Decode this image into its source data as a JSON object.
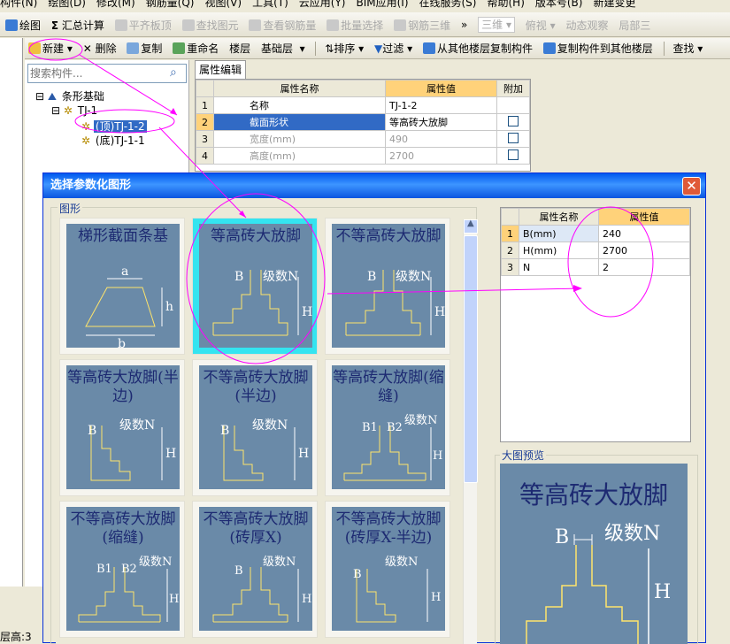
{
  "menu": [
    "构件(N)",
    "绘图(D)",
    "修改(M)",
    "钢筋量(Q)",
    "视图(V)",
    "工具(T)",
    "云应用(Y)",
    "BIM应用(I)",
    "在线服务(S)",
    "帮助(H)",
    "版本号(B)",
    "新建变更"
  ],
  "toolbar1": {
    "draw": "绘图",
    "sum": "汇总计算",
    "flat": "平齐板顶",
    "find": "查找图元",
    "view_rebar": "查看钢筋量",
    "batch": "批量选择",
    "rebar3d": "钢筋三维",
    "more": "»",
    "view_combo": "三维",
    "top_view": "俯视",
    "dynamic": "动态观察",
    "local": "局部三"
  },
  "toolbar2": {
    "new": "新建",
    "delete": "删除",
    "copy": "复制",
    "rename": "重命名",
    "floor_label": "楼层",
    "floor_value": "基础层",
    "sort": "排序",
    "filter": "过滤",
    "copy_from": "从其他楼层复制构件",
    "copy_to": "复制构件到其他楼层",
    "find": "查找"
  },
  "search": {
    "placeholder": "搜索构件..."
  },
  "tree": {
    "root": "条形基础",
    "node": "TJ-1",
    "child1": "(顶)TJ-1-2",
    "child2": "(底)TJ-1-1"
  },
  "prop_tab": "属性编辑",
  "prop_headers": {
    "name": "属性名称",
    "value": "属性值",
    "extra": "附加"
  },
  "props": [
    {
      "n": "1",
      "name": "名称",
      "value": "TJ-1-2"
    },
    {
      "n": "2",
      "name": "截面形状",
      "value": "等高砖大放脚"
    },
    {
      "n": "3",
      "name": "宽度(mm)",
      "value": "490"
    },
    {
      "n": "4",
      "name": "高度(mm)",
      "value": "2700"
    }
  ],
  "dialog": {
    "title": "选择参数化图形",
    "close": "✕",
    "group_label": "图形",
    "preview_label": "大图预览"
  },
  "tiles": [
    {
      "title": "梯形截面条基"
    },
    {
      "title": "等高砖大放脚"
    },
    {
      "title": "不等高砖大放脚"
    },
    {
      "title": "等高砖大放脚(半边)"
    },
    {
      "title": "不等高砖大放脚(半边)"
    },
    {
      "title": "等高砖大放脚(缩缝)"
    },
    {
      "title": "不等高砖大放脚(缩缝)"
    },
    {
      "title": "不等高砖大放脚(砖厚X)"
    },
    {
      "title": "不等高砖大放脚(砖厚X-半边)"
    }
  ],
  "tile_labels": {
    "a": "a",
    "b": "b",
    "h": "h",
    "B": "B",
    "H": "H",
    "N": "级数N",
    "B1": "B1",
    "B2": "B2"
  },
  "params": [
    {
      "n": "1",
      "name": "B(mm)",
      "value": "240"
    },
    {
      "n": "2",
      "name": "H(mm)",
      "value": "2700"
    },
    {
      "n": "3",
      "name": "N",
      "value": "2"
    }
  ],
  "big_preview": {
    "title": "等高砖大放脚"
  },
  "status": "层高:3"
}
